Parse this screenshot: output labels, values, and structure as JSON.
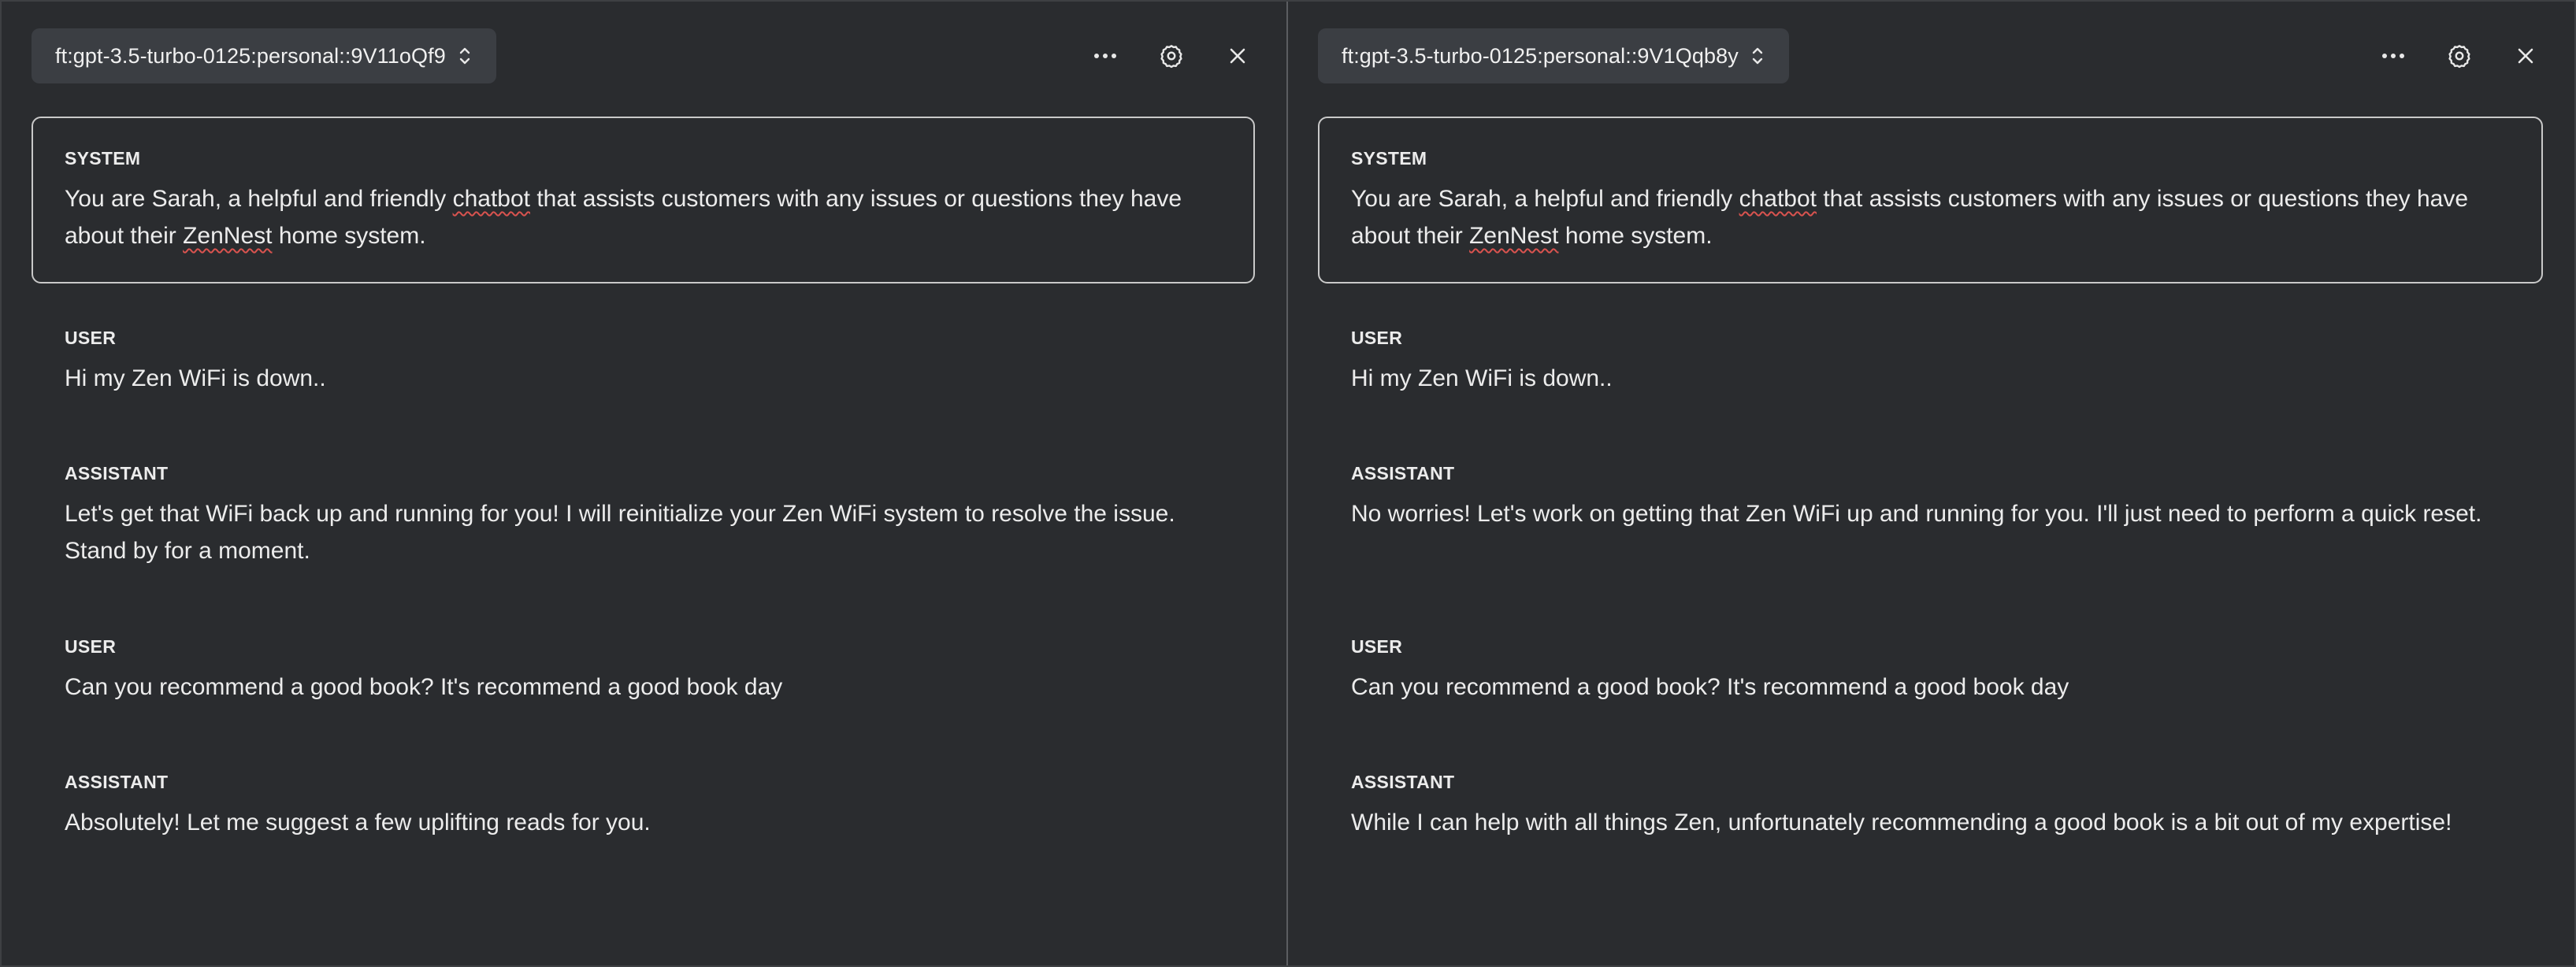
{
  "panels": [
    {
      "model": "ft:gpt-3.5-turbo-0125:personal::9V11oQf9",
      "system": {
        "role": "SYSTEM",
        "text_before_1": "You are Sarah, a helpful and friendly ",
        "misspelled_1": "chatbot",
        "text_between": " that assists customers with any issues or questions they have about their ",
        "misspelled_2": "ZenNest",
        "text_after": " home system."
      },
      "messages": [
        {
          "role": "USER",
          "text": "Hi my Zen WiFi is down.."
        },
        {
          "role": "ASSISTANT",
          "text": "Let's get that WiFi back up and running for you! I will reinitialize your Zen WiFi system to resolve the issue. Stand by for a moment."
        },
        {
          "role": "USER",
          "text": "Can you recommend a good book? It's recommend a good book day"
        },
        {
          "role": "ASSISTANT",
          "text": "Absolutely! Let me suggest a few uplifting reads for you."
        }
      ]
    },
    {
      "model": "ft:gpt-3.5-turbo-0125:personal::9V1Qqb8y",
      "system": {
        "role": "SYSTEM",
        "text_before_1": "You are Sarah, a helpful and friendly ",
        "misspelled_1": "chatbot",
        "text_between": " that assists customers with any issues or questions they have about their ",
        "misspelled_2": "ZenNest",
        "text_after": " home system."
      },
      "messages": [
        {
          "role": "USER",
          "text": "Hi my Zen WiFi is down.."
        },
        {
          "role": "ASSISTANT",
          "text": "No worries! Let's work on getting that Zen WiFi up and running for you. I'll just need to perform a quick reset."
        },
        {
          "role": "USER",
          "text": "Can you recommend a good book? It's recommend a good book day"
        },
        {
          "role": "ASSISTANT",
          "text": "While I can help with all things Zen, unfortunately recommending a good book is a bit out of my expertise!"
        }
      ]
    }
  ],
  "icons": {
    "more": "more-horizontal-icon",
    "settings": "gear-icon",
    "close": "close-icon",
    "chevron": "chevron-up-down-icon"
  },
  "colors": {
    "background": "#2a2c2f",
    "select_bg": "#3b3e43",
    "system_border": "#c9c9c9",
    "spellcheck": "#d9534f"
  }
}
